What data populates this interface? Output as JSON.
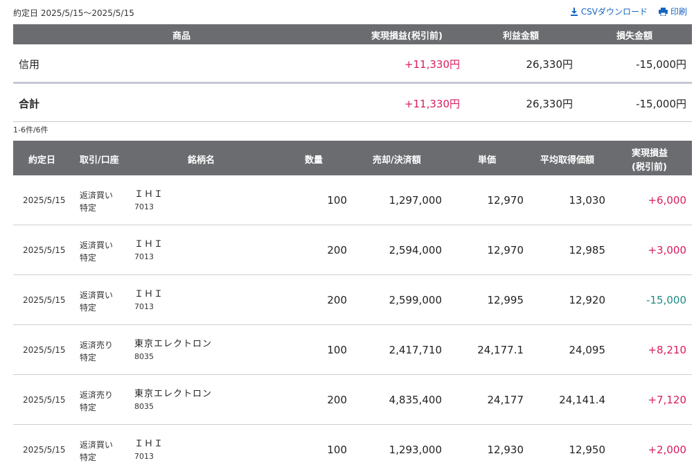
{
  "header": {
    "date_range": "約定日 2025/5/15〜2025/5/15",
    "csv_label": "CSVダウンロード",
    "print_label": "印刷"
  },
  "summary": {
    "columns": [
      "商品",
      "実現損益(税引前)",
      "利益金額",
      "損失金額"
    ],
    "rows": [
      {
        "product": "信用",
        "realized": "+11,330円",
        "profit": "26,330円",
        "loss": "-15,000円"
      },
      {
        "product": "合計",
        "realized": "+11,330円",
        "profit": "26,330円",
        "loss": "-15,000円"
      }
    ]
  },
  "result_count": "1-6件/6件",
  "detail": {
    "columns": {
      "date": "約定日",
      "type": "取引/口座",
      "name": "銘柄名",
      "qty": "数量",
      "amount": "売却/決済額",
      "unit": "単価",
      "avg": "平均取得価額",
      "pl_line1": "実現損益",
      "pl_line2": "(税引前)"
    },
    "rows": [
      {
        "date": "2025/5/15",
        "trade": "返済買い",
        "account": "特定",
        "name": "ＩＨＩ",
        "code": "7013",
        "qty": "100",
        "amount": "1,297,000",
        "unit": "12,970",
        "avg": "13,030",
        "pl": "+6,000",
        "sign": "plus"
      },
      {
        "date": "2025/5/15",
        "trade": "返済買い",
        "account": "特定",
        "name": "ＩＨＩ",
        "code": "7013",
        "qty": "200",
        "amount": "2,594,000",
        "unit": "12,970",
        "avg": "12,985",
        "pl": "+3,000",
        "sign": "plus"
      },
      {
        "date": "2025/5/15",
        "trade": "返済買い",
        "account": "特定",
        "name": "ＩＨＩ",
        "code": "7013",
        "qty": "200",
        "amount": "2,599,000",
        "unit": "12,995",
        "avg": "12,920",
        "pl": "-15,000",
        "sign": "minus"
      },
      {
        "date": "2025/5/15",
        "trade": "返済売り",
        "account": "特定",
        "name": "東京エレクトロン",
        "code": "8035",
        "qty": "100",
        "amount": "2,417,710",
        "unit": "24,177.1",
        "avg": "24,095",
        "pl": "+8,210",
        "sign": "plus"
      },
      {
        "date": "2025/5/15",
        "trade": "返済売り",
        "account": "特定",
        "name": "東京エレクトロン",
        "code": "8035",
        "qty": "200",
        "amount": "4,835,400",
        "unit": "24,177",
        "avg": "24,141.4",
        "pl": "+7,120",
        "sign": "plus"
      },
      {
        "date": "2025/5/15",
        "trade": "返済買い",
        "account": "特定",
        "name": "ＩＨＩ",
        "code": "7013",
        "qty": "100",
        "amount": "1,293,000",
        "unit": "12,930",
        "avg": "12,950",
        "pl": "+2,000",
        "sign": "plus"
      }
    ]
  },
  "colors": {
    "header_bg": "#6a6c70",
    "link": "#1565c0",
    "profit": "#d81b60",
    "loss": "#1e8a83"
  }
}
